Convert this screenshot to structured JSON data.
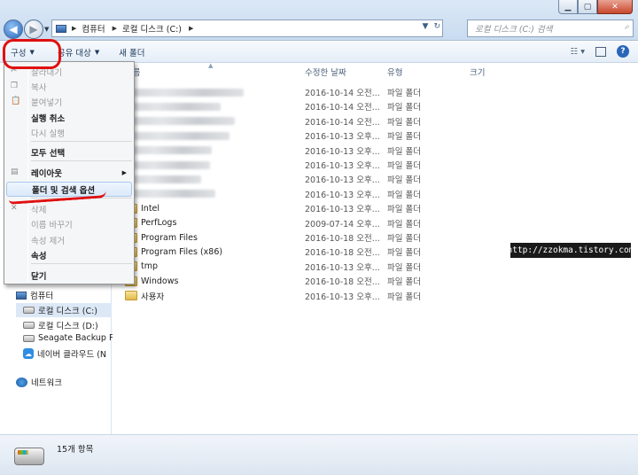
{
  "window": {
    "minimize_glyph": "▁",
    "maximize_glyph": "▢",
    "close_glyph": "✕"
  },
  "address": {
    "crumbs": [
      "컴퓨터",
      "로컬 디스크 (C:)"
    ],
    "search_placeholder": "로컬 디스크 (C:) 검색"
  },
  "toolbar": {
    "organize": "구성",
    "share": "공유 대상",
    "new_folder": "새 폴더"
  },
  "columns": {
    "name": "이름",
    "date": "수정한 날짜",
    "type": "유형",
    "size": "크기"
  },
  "files": [
    {
      "name": "",
      "date": "2016-10-14 오전...",
      "type": "파일 폴더",
      "blurred": true
    },
    {
      "name": "",
      "date": "2016-10-14 오전...",
      "type": "파일 폴더",
      "blurred": true
    },
    {
      "name": "",
      "date": "2016-10-14 오전...",
      "type": "파일 폴더",
      "blurred": true
    },
    {
      "name": "",
      "date": "2016-10-13 오후...",
      "type": "파일 폴더",
      "blurred": true
    },
    {
      "name": "",
      "date": "2016-10-13 오후...",
      "type": "파일 폴더",
      "blurred": true
    },
    {
      "name": "",
      "date": "2016-10-13 오후...",
      "type": "파일 폴더",
      "blurred": true
    },
    {
      "name": "",
      "date": "2016-10-13 오후...",
      "type": "파일 폴더",
      "blurred": true
    },
    {
      "name": "",
      "date": "2016-10-13 오후...",
      "type": "파일 폴더",
      "blurred": true
    },
    {
      "name": "Intel",
      "date": "2016-10-13 오후...",
      "type": "파일 폴더",
      "blurred": false
    },
    {
      "name": "PerfLogs",
      "date": "2009-07-14 오후...",
      "type": "파일 폴더",
      "blurred": false
    },
    {
      "name": "Program Files",
      "date": "2016-10-18 오전...",
      "type": "파일 폴더",
      "blurred": false
    },
    {
      "name": "Program Files (x86)",
      "date": "2016-10-18 오전...",
      "type": "파일 폴더",
      "blurred": false
    },
    {
      "name": "tmp",
      "date": "2016-10-13 오후...",
      "type": "파일 폴더",
      "blurred": false
    },
    {
      "name": "Windows",
      "date": "2016-10-18 오전...",
      "type": "파일 폴더",
      "blurred": false
    },
    {
      "name": "사용자",
      "date": "2016-10-13 오후...",
      "type": "파일 폴더",
      "blurred": false
    }
  ],
  "menu": {
    "items": [
      {
        "label": "잘라내기",
        "state": "disabled"
      },
      {
        "label": "복사",
        "state": "disabled"
      },
      {
        "label": "붙여넣기",
        "state": "disabled"
      },
      {
        "label": "실행 취소",
        "state": "enabled"
      },
      {
        "label": "다시 실행",
        "state": "disabled"
      },
      {
        "label": "모두 선택",
        "state": "enabled"
      },
      {
        "label": "레이아웃",
        "state": "submenu"
      },
      {
        "label": "폴더 및 검색 옵션",
        "state": "highlighted"
      },
      {
        "label": "삭제",
        "state": "disabled"
      },
      {
        "label": "이름 바꾸기",
        "state": "disabled"
      },
      {
        "label": "속성 제거",
        "state": "disabled"
      },
      {
        "label": "속성",
        "state": "enabled"
      },
      {
        "label": "닫기",
        "state": "enabled"
      }
    ]
  },
  "sidebar": {
    "computer": "컴퓨터",
    "drives": [
      "로컬 디스크 (C:)",
      "로컬 디스크 (D:)",
      "Seagate Backup Plu",
      "네이버 클라우드 (N"
    ],
    "network": "네트워크"
  },
  "status": {
    "item_count": "15개 항목"
  },
  "watermark": "http://zzokma.tistory.com",
  "colors": {
    "annotation": "#e01010",
    "selection": "#dce8f6"
  }
}
